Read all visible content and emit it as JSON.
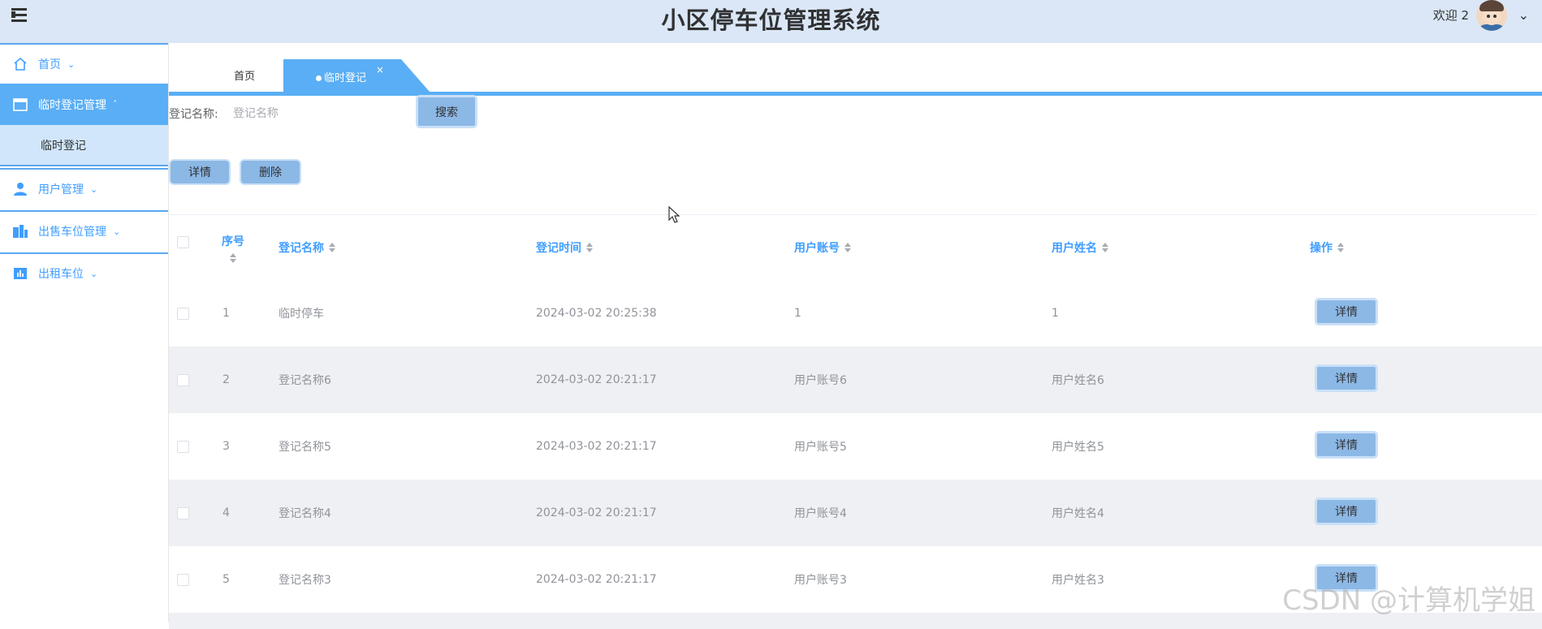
{
  "header": {
    "app_title": "小区停车位管理系统",
    "welcome": "欢迎 2",
    "chevron": "⌄"
  },
  "sidebar": {
    "items": [
      {
        "label": "首页",
        "icon": "home-icon"
      },
      {
        "label": "临时登记管理",
        "icon": "folder-icon",
        "expanded": true
      },
      {
        "label": "用户管理",
        "icon": "user-icon"
      },
      {
        "label": "出售车位管理",
        "icon": "building-icon"
      },
      {
        "label": "出租车位",
        "icon": "chart-icon"
      }
    ],
    "subitems": [
      {
        "label": "临时登记"
      }
    ]
  },
  "tabs": {
    "home": "首页",
    "active": "临时登记",
    "close": "×"
  },
  "search": {
    "label": "登记名称:",
    "placeholder": "登记名称",
    "button": "搜索"
  },
  "actions": {
    "detail": "详情",
    "delete": "删除"
  },
  "table": {
    "columns": [
      "序号",
      "登记名称",
      "登记时间",
      "用户账号",
      "用户姓名",
      "操作"
    ],
    "rows": [
      {
        "index": "1",
        "name": "临时停车",
        "time": "2024-03-02 20:25:38",
        "account": "1",
        "username": "1",
        "action": "详情"
      },
      {
        "index": "2",
        "name": "登记名称6",
        "time": "2024-03-02 20:21:17",
        "account": "用户账号6",
        "username": "用户姓名6",
        "action": "详情"
      },
      {
        "index": "3",
        "name": "登记名称5",
        "time": "2024-03-02 20:21:17",
        "account": "用户账号5",
        "username": "用户姓名5",
        "action": "详情"
      },
      {
        "index": "4",
        "name": "登记名称4",
        "time": "2024-03-02 20:21:17",
        "account": "用户账号4",
        "username": "用户姓名4",
        "action": "详情"
      },
      {
        "index": "5",
        "name": "登记名称3",
        "time": "2024-03-02 20:21:17",
        "account": "用户账号3",
        "username": "用户姓名3",
        "action": "详情"
      }
    ]
  },
  "watermark": "CSDN @计算机学姐",
  "colors": {
    "header_bg": "#dbe7f6",
    "accent": "#409eff",
    "active_menu": "#5aaef5",
    "button": "#8cb8e6"
  }
}
